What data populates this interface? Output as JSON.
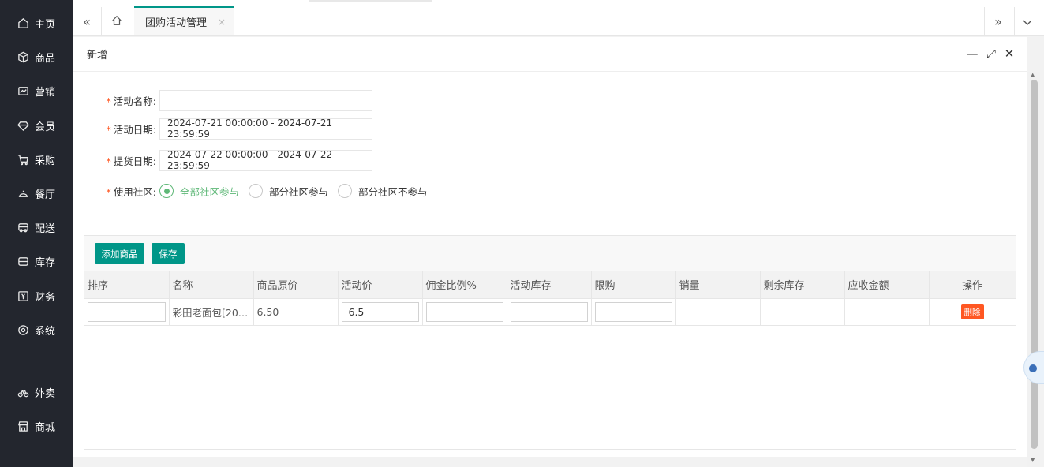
{
  "sidebar": {
    "items": [
      {
        "label": "主页",
        "icon": "home-icon"
      },
      {
        "label": "商品",
        "icon": "box-icon"
      },
      {
        "label": "营销",
        "icon": "chart-icon"
      },
      {
        "label": "会员",
        "icon": "diamond-icon"
      },
      {
        "label": "采购",
        "icon": "cart-icon"
      },
      {
        "label": "餐厅",
        "icon": "restaurant-icon"
      },
      {
        "label": "配送",
        "icon": "truck-icon"
      },
      {
        "label": "库存",
        "icon": "inbox-icon"
      },
      {
        "label": "财务",
        "icon": "finance-icon"
      },
      {
        "label": "系统",
        "icon": "settings-icon"
      },
      {
        "label": "外卖",
        "icon": "bike-icon"
      },
      {
        "label": "商城",
        "icon": "shop-icon"
      }
    ]
  },
  "topbar": {
    "collapse_icon": "double-left-icon",
    "home_icon": "home-outline-icon",
    "tab_label": "团购活动管理",
    "tab_close": "×",
    "next_icon": "double-right-icon",
    "more_icon": "chevron-down-icon"
  },
  "dialog": {
    "title": "新增",
    "minimize": "—",
    "maximize": "⤢",
    "close": "✕"
  },
  "form": {
    "name_label": "活动名称:",
    "name_value": "",
    "date_label": "活动日期:",
    "date_value": "2024-07-21 00:00:00 - 2024-07-21 23:59:59",
    "pickup_label": "提货日期:",
    "pickup_value": "2024-07-22 00:00:00 - 2024-07-22 23:59:59",
    "community_label": "使用社区:",
    "community_options": [
      "全部社区参与",
      "部分社区参与",
      "部分社区不参与"
    ],
    "community_selected": "全部社区参与",
    "required_mark": "*"
  },
  "toolbar": {
    "add_label": "添加商品",
    "save_label": "保存"
  },
  "table": {
    "columns": [
      "排序",
      "名称",
      "商品原价",
      "活动价",
      "佣金比例%",
      "活动库存",
      "限购",
      "销量",
      "剩余库存",
      "应收金额",
      "操作"
    ],
    "rows": [
      {
        "sort": "",
        "name": "彩田老面包[20…",
        "price": "6.50",
        "activity_price": "6.5",
        "commission": "",
        "stock": "",
        "limit": "",
        "sales": "",
        "remaining": "",
        "receivable": "",
        "action": "删除"
      }
    ]
  },
  "colors": {
    "accent": "#009688",
    "danger": "#ff5722",
    "radio": "#5fb878",
    "sidebar": "#23262e"
  }
}
